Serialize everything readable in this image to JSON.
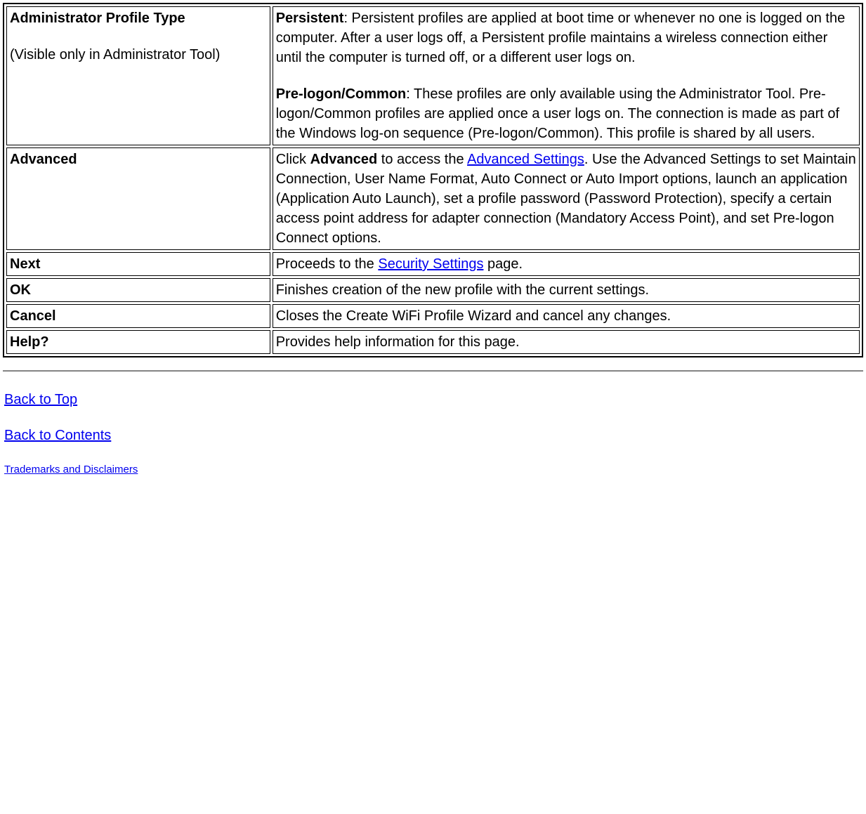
{
  "rows": [
    {
      "label_bold": "Administrator Profile Type",
      "label_extra": "(Visible only in Administrator Tool)",
      "desc_segments": [
        {
          "bold": true,
          "text": "Persistent"
        },
        {
          "bold": false,
          "text": ": Persistent profiles are applied at boot time or whenever no one is logged on the computer. After a user logs off, a Persistent profile maintains a wireless connection either until the computer is turned off, or a different user logs on."
        },
        {
          "break": true
        },
        {
          "bold": true,
          "text": "Pre-logon/Common"
        },
        {
          "bold": false,
          "text": ": These profiles are only available using the Administrator Tool. Pre-logon/Common profiles are applied once a user logs on. The connection is made as part of the Windows log-on sequence (Pre-logon/Common). This profile is shared by all users."
        }
      ]
    },
    {
      "label_bold": "Advanced",
      "desc_segments": [
        {
          "bold": false,
          "text": "Click "
        },
        {
          "bold": true,
          "text": "Advanced"
        },
        {
          "bold": false,
          "text": " to access the "
        },
        {
          "link": true,
          "text": "Advanced Settings"
        },
        {
          "bold": false,
          "text": ". Use the Advanced Settings to set Maintain Connection, User Name Format, Auto Connect or Auto Import options, launch an application (Application Auto Launch), set a profile password (Password Protection), specify a certain access point address for adapter connection (Mandatory Access Point), and set Pre-logon Connect options."
        }
      ]
    },
    {
      "label_bold": "Next",
      "desc_segments": [
        {
          "bold": false,
          "text": "Proceeds to the "
        },
        {
          "link": true,
          "text": "Security Settings"
        },
        {
          "bold": false,
          "text": " page."
        }
      ]
    },
    {
      "label_bold": "OK",
      "desc_segments": [
        {
          "bold": false,
          "text": "Finishes creation of the new profile with the current settings."
        }
      ]
    },
    {
      "label_bold": "Cancel",
      "desc_segments": [
        {
          "bold": false,
          "text": "Closes the Create WiFi Profile Wizard and cancel any changes."
        }
      ]
    },
    {
      "label_bold": "Help?",
      "desc_segments": [
        {
          "bold": false,
          "text": "Provides help information for this page."
        }
      ]
    }
  ],
  "footer": {
    "back_to_top": "Back to Top",
    "back_to_contents": "Back to Contents",
    "trademarks": "Trademarks and Disclaimers"
  }
}
